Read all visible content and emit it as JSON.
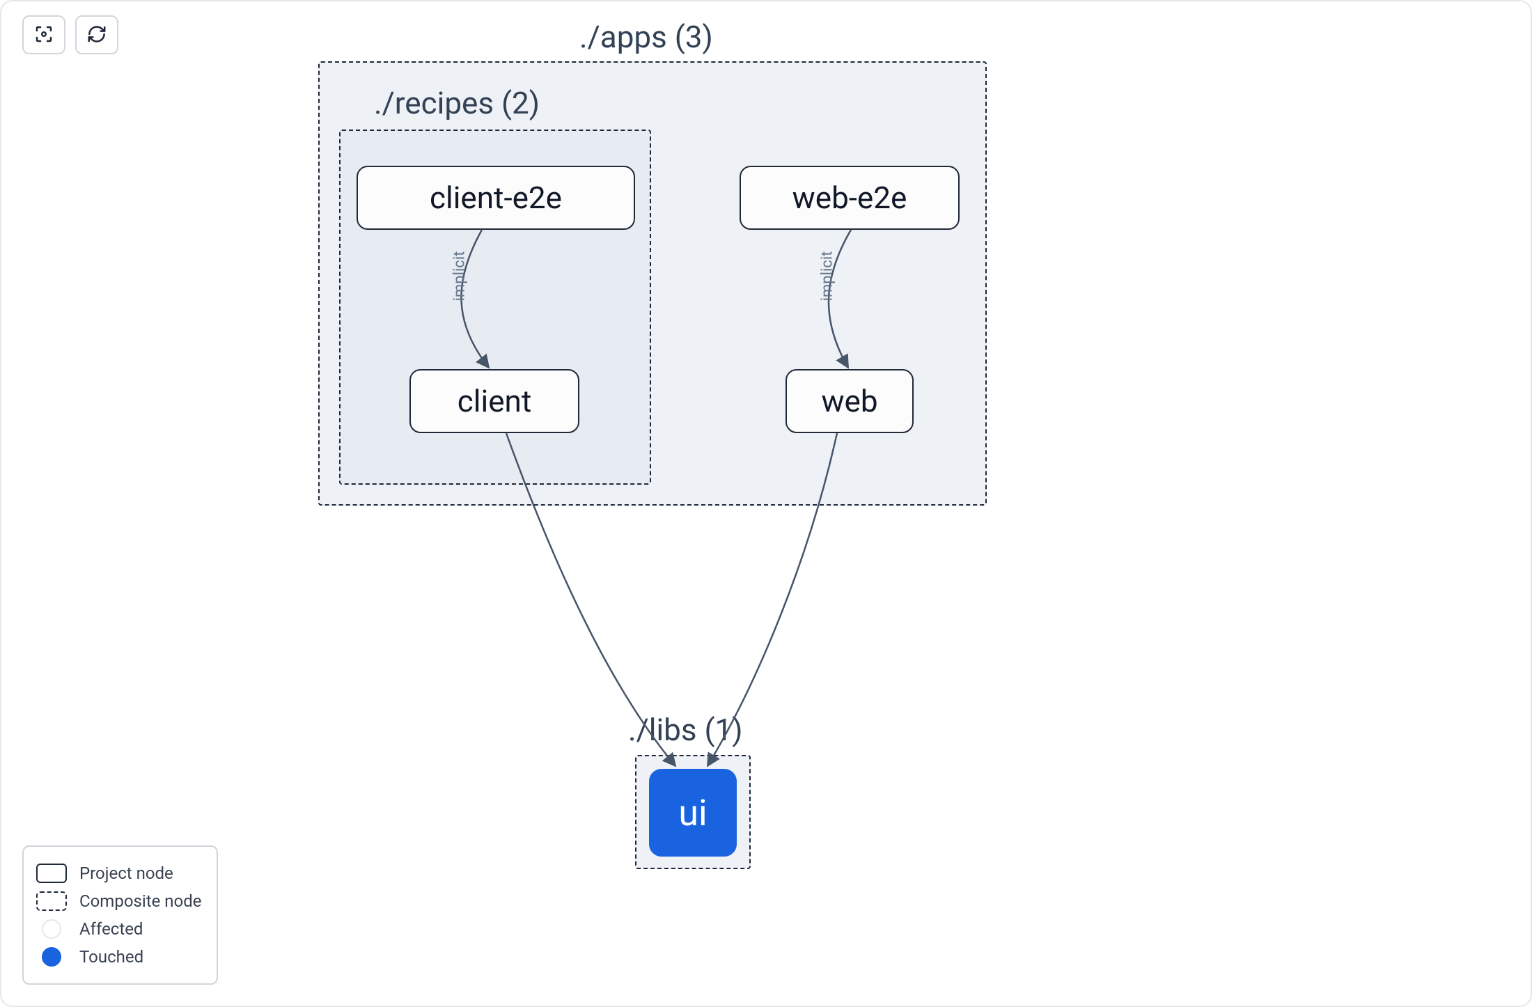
{
  "groups": {
    "apps": {
      "label": "./apps (3)"
    },
    "recipes": {
      "label": "./recipes (2)"
    },
    "libs": {
      "label": "./libs (1)"
    }
  },
  "nodes": {
    "client_e2e": {
      "label": "client-e2e"
    },
    "client": {
      "label": "client"
    },
    "web_e2e": {
      "label": "web-e2e"
    },
    "web": {
      "label": "web"
    },
    "ui": {
      "label": "ui"
    }
  },
  "edges": {
    "client_e2e_to_client": {
      "label": "implicit"
    },
    "web_e2e_to_web": {
      "label": "implicit"
    }
  },
  "legend": {
    "project": "Project node",
    "composite": "Composite node",
    "affected": "Affected",
    "touched": "Touched"
  }
}
